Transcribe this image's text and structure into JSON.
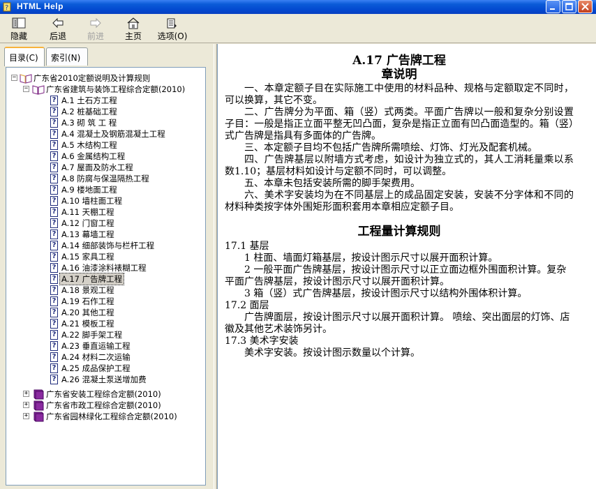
{
  "window": {
    "title": "HTML Help"
  },
  "toolbar": {
    "hide": "隐藏",
    "back": "后退",
    "forward": "前进",
    "home": "主页",
    "options": "选项(O)"
  },
  "tabs": {
    "contents": "目录(C)",
    "index": "索引(N)"
  },
  "tree": {
    "root": "广东省2010定额说明及计算规则",
    "book1": "广东省建筑与装饰工程综合定额(2010)",
    "items": [
      "A.1  土石方工程",
      "A.2  桩基础工程",
      "A.3  砌 筑 工 程",
      "A.4  混凝土及钢筋混凝土工程",
      "A.5  木结构工程",
      "A.6  金属结构工程",
      "A.7 屋面及防水工程",
      "A.8  防腐与保温隔热工程",
      "A.9  楼地面工程",
      "A.10  墙柱面工程",
      "A.11  天棚工程",
      "A.12  门窗工程",
      "A.13  幕墙工程",
      "A.14  细部装饰与栏杆工程",
      "A.15  家具工程",
      "A.16  油漆涂料裱糊工程",
      "A.17  广告牌工程",
      "A.18 景观工程",
      "A.19 石作工程",
      "A.20  其他工程",
      "A.21  模板工程",
      "A.22  脚手架工程",
      "A.23  垂直运输工程",
      "A.24  材料二次运输",
      "A.25  成品保护工程",
      "A.26  混凝土泵送增加费"
    ],
    "books": [
      "广东省安装工程综合定额(2010)",
      "广东省市政工程综合定额(2010)",
      "广东省园林绿化工程综合定额(2010)"
    ]
  },
  "content": {
    "title": "A.17  广告牌工程",
    "subtitle": "章说明",
    "paragraphs": [
      "一、本章定额子目在实际施工中使用的材料品种、规格与定额取定不同时，可以换算，其它不变。",
      "二、广告牌分为平面、箱（竖）式两类。平面广告牌以一般和复杂分别设置子目：一般是指正立面平整无凹凸面，复杂是指正立面有凹凸面造型的。箱（竖）式广告牌是指具有多面体的广告牌。",
      "三、本定额子目均不包括广告牌所需喷绘、灯饰、灯光及配套机械。",
      "四、广告牌基层以附墙方式考虑，如设计为独立式的，其人工消耗量乘以系数1.10；基层材料如设计与定额不同时，可以调整。",
      "五、本章未包括安装所需的脚手架费用。",
      "六、美术字安装均为在不同基层上的成品固定安装，安装不分字体和不同的材料种类按字体外围矩形面积套用本章相应定额子目。"
    ],
    "rules_title": "工程量计算规则",
    "r1": "17.1  基层",
    "r1a": "1  柱面、墙面灯箱基层，按设计图示尺寸以展开面积计算。",
    "r1b": "2  一般平面广告牌基层，按设计图示尺寸以正立面边框外围面积计算。复杂平面广告牌基层，按设计图示尺寸以展开面积计算。",
    "r1c": "3  箱（竖）式广告牌基层，按设计图示尺寸以结构外围体积计算。",
    "r2": "17.2  面层",
    "r2a": "广告牌面层，按设计图示尺寸以展开面积计算。  喷绘、突出面层的灯饰、店徽及其他艺术装饰另计。",
    "r3": "17.3  美术字安装",
    "r3a": "美术字安装。按设计图示数量以个计算。"
  }
}
